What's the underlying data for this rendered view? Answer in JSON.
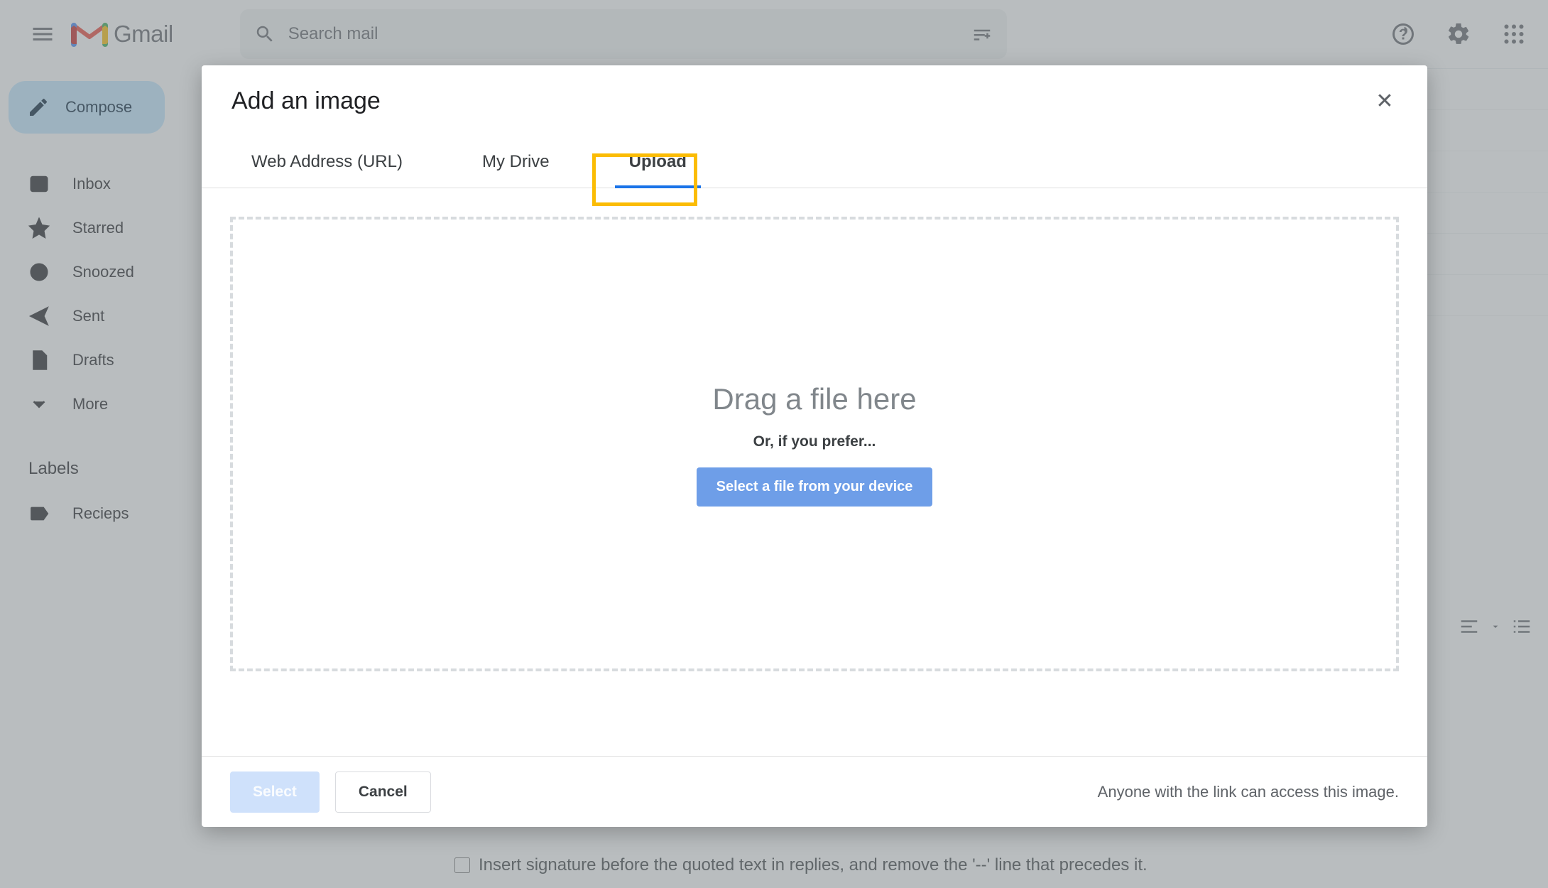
{
  "header": {
    "product_name": "Gmail",
    "search_placeholder": "Search mail"
  },
  "sidebar": {
    "compose_label": "Compose",
    "items": [
      {
        "label": "Inbox"
      },
      {
        "label": "Starred"
      },
      {
        "label": "Snoozed"
      },
      {
        "label": "Sent"
      },
      {
        "label": "Drafts"
      },
      {
        "label": "More"
      }
    ],
    "labels_heading": "Labels",
    "labels": [
      {
        "label": "Recieps"
      }
    ]
  },
  "settings_row": {
    "checkbox_label": "Insert signature before the quoted text in replies, and remove the '--' line that precedes it."
  },
  "modal": {
    "title": "Add an image",
    "tabs": [
      {
        "label": "Web Address (URL)"
      },
      {
        "label": "My Drive"
      },
      {
        "label": "Upload"
      }
    ],
    "active_tab_index": 2,
    "dropzone": {
      "title": "Drag a file here",
      "subtitle": "Or, if you prefer...",
      "button_label": "Select a file from your device"
    },
    "footer": {
      "select_label": "Select",
      "cancel_label": "Cancel",
      "note": "Anyone with the link can access this image."
    }
  }
}
